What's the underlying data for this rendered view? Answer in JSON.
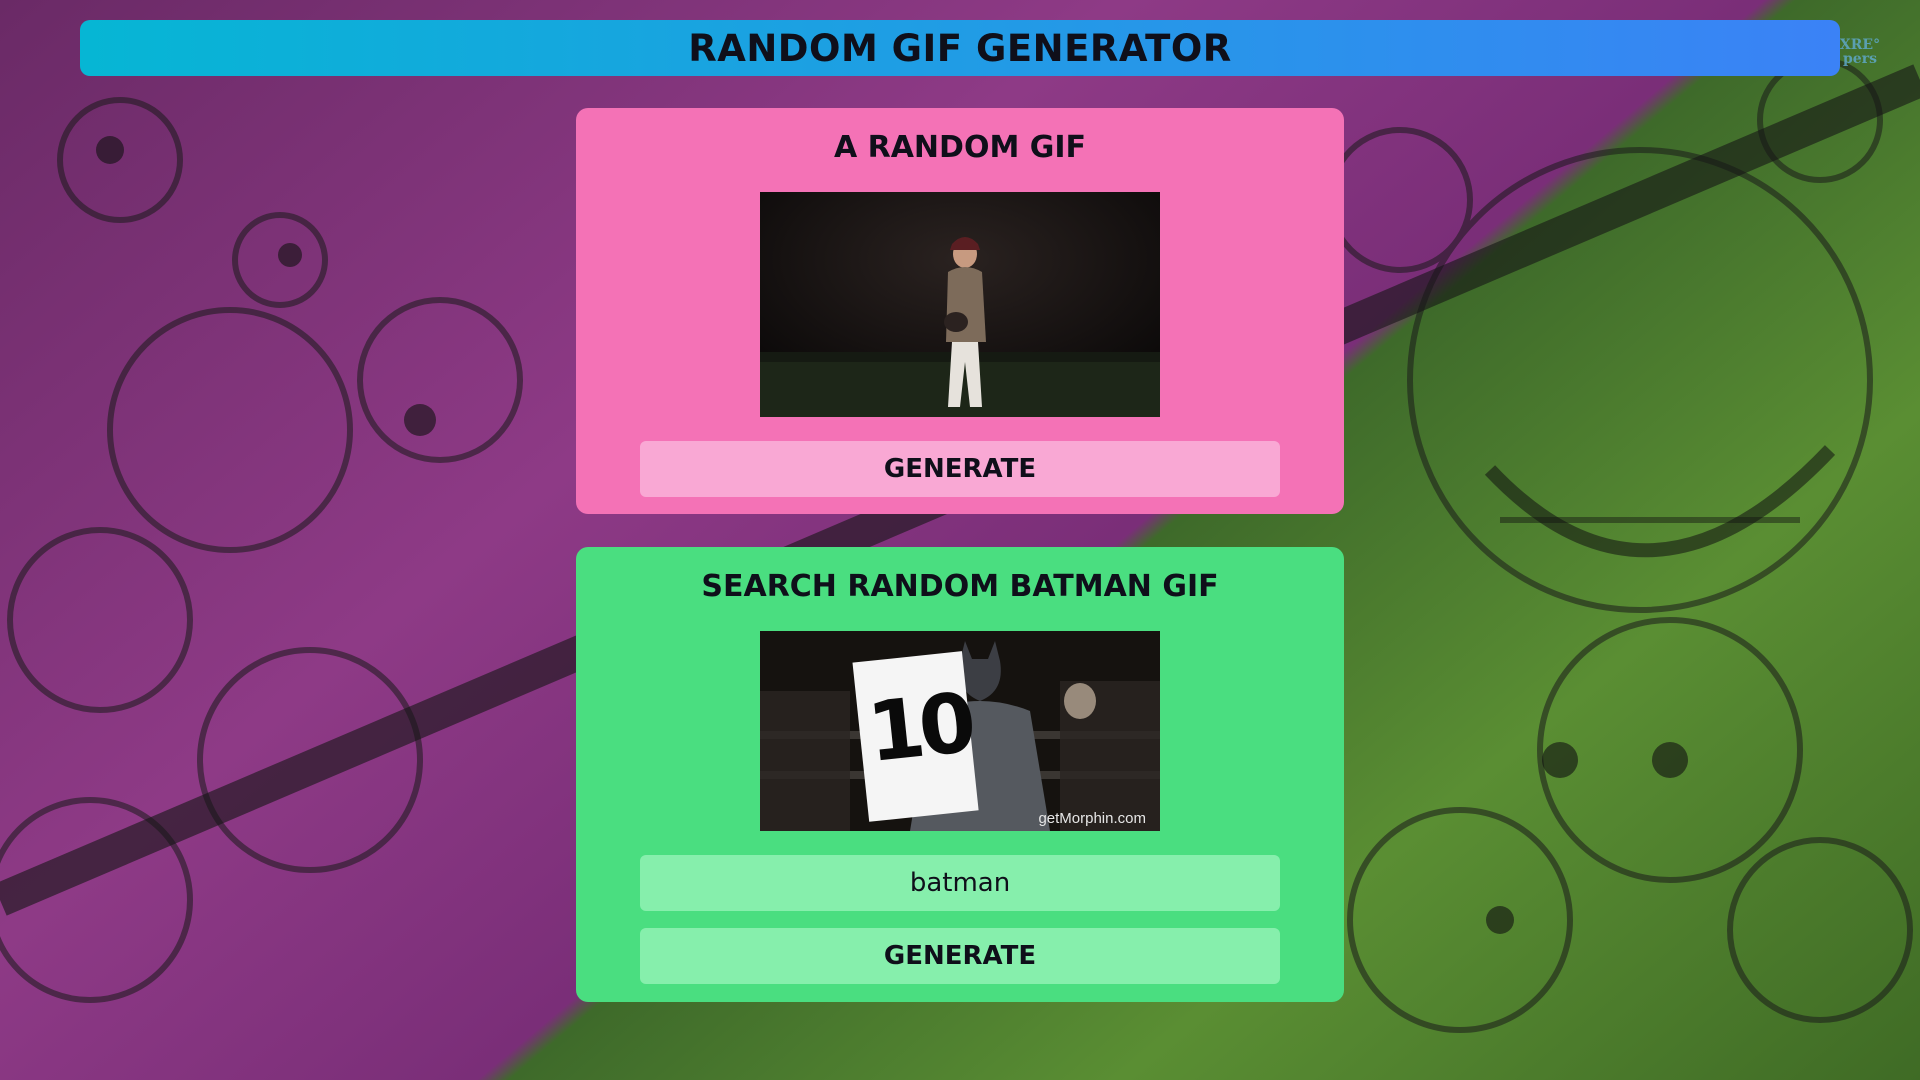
{
  "header": {
    "title": "RANDOM GIF GENERATOR",
    "watermark": "XRE° pers"
  },
  "random_card": {
    "title": "A RANDOM GIF",
    "gif_icon": "baseball-pitcher-gif",
    "generate_label": "GENERATE"
  },
  "search_card": {
    "title": "SEARCH RANDOM BATMAN GIF",
    "gif_icon": "batman-score-card-gif",
    "gif_card_text": "10",
    "gif_watermark": "getMorphin.com",
    "search_value": "batman",
    "generate_label": "GENERATE"
  },
  "colors": {
    "header_gradient_start": "#06b6d4",
    "header_gradient_end": "#3b82f6",
    "random_card_bg": "#f472b6",
    "random_button_bg": "#f9a8d4",
    "search_card_bg": "#4ade80",
    "search_button_bg": "#86efac"
  }
}
